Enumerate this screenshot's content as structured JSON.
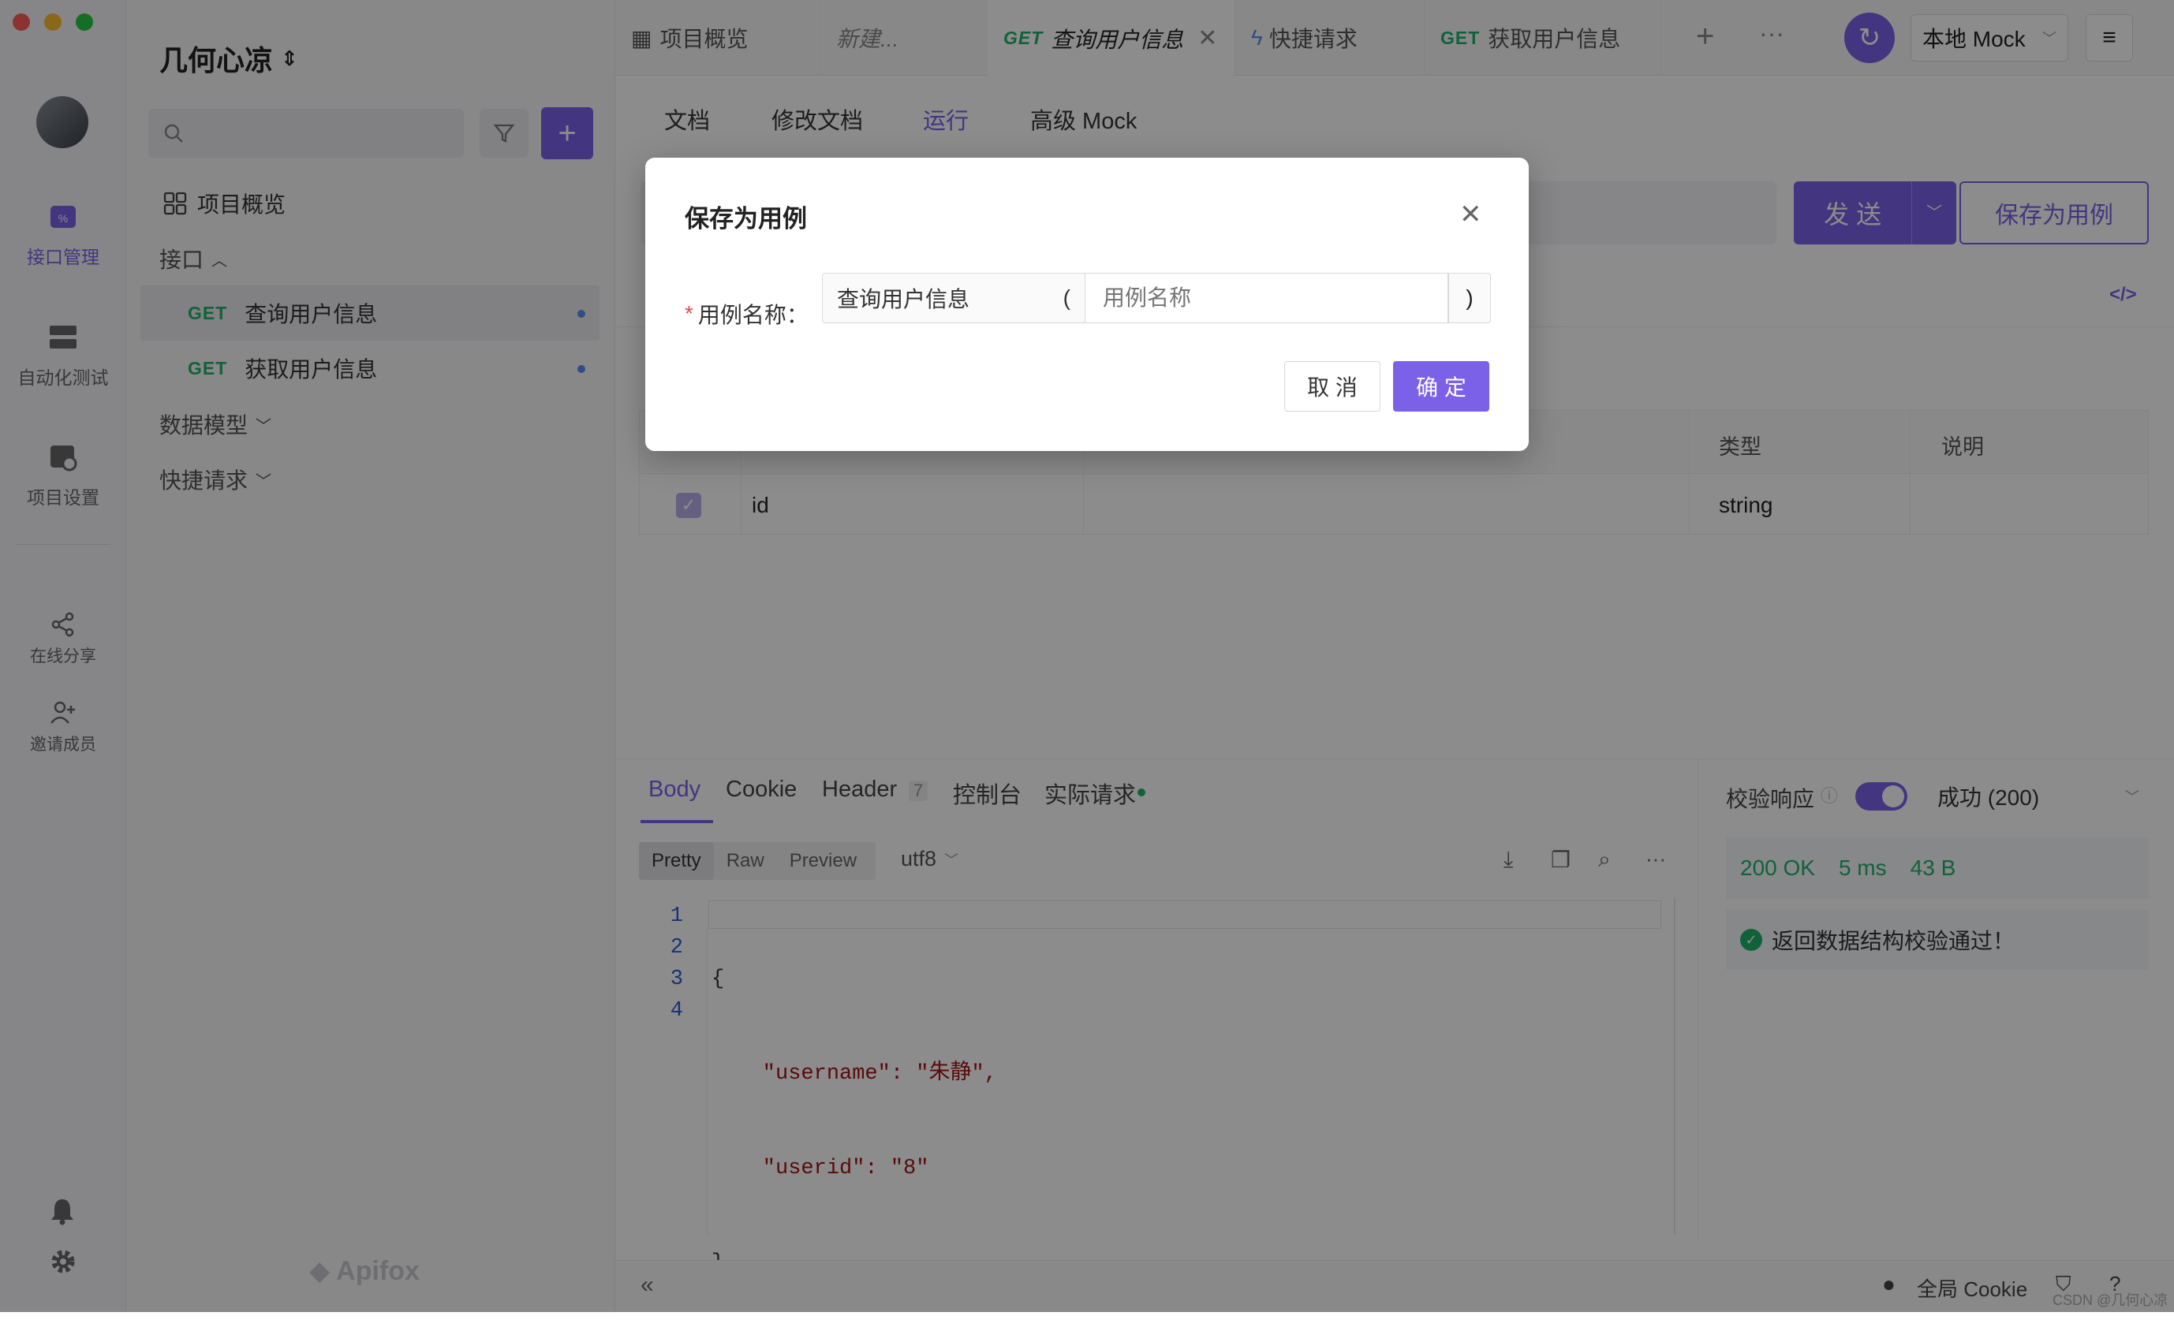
{
  "rail": {
    "items": [
      {
        "label": "接口管理",
        "icon": "api-icon"
      },
      {
        "label": "自动化测试",
        "icon": "automation-icon"
      },
      {
        "label": "项目设置",
        "icon": "settings-icon"
      },
      {
        "label": "在线分享",
        "icon": "share-icon"
      },
      {
        "label": "邀请成员",
        "icon": "invite-icon"
      }
    ]
  },
  "sidebar": {
    "project_name": "几何心凉",
    "overview": "项目概览",
    "interfaces_group": "接口",
    "interfaces": [
      {
        "method": "GET",
        "name": "查询用户信息"
      },
      {
        "method": "GET",
        "name": "获取用户信息"
      }
    ],
    "data_models": "数据模型",
    "quick_requests": "快捷请求",
    "brand": "Apifox"
  },
  "tabs": [
    {
      "label": "项目概览"
    },
    {
      "label": "新建..."
    },
    {
      "method": "GET",
      "label": "查询用户信息"
    },
    {
      "label": "快捷请求"
    },
    {
      "method": "GET",
      "label": "获取用户信息"
    }
  ],
  "env_select": "本地 Mock",
  "subtabs": [
    "文档",
    "修改文档",
    "运行",
    "高级 Mock"
  ],
  "send_button": "发 送",
  "save_case_button": "保存为用例",
  "params_table": {
    "headers": [
      "类型",
      "说明"
    ],
    "rows": [
      {
        "name": "id",
        "type": "string"
      }
    ]
  },
  "response": {
    "tabs": [
      "Body",
      "Cookie",
      "Header",
      "控制台",
      "实际请求"
    ],
    "header_count": "7",
    "format_tabs": [
      "Pretty",
      "Raw",
      "Preview"
    ],
    "encoding": "utf8",
    "code_lines": [
      "{",
      "    \"username\": \"朱静\",",
      "    \"userid\": \"8\"",
      "}"
    ],
    "line_numbers": [
      "1",
      "2",
      "3",
      "4"
    ],
    "validate_label": "校验响应",
    "status_select": "成功 (200)",
    "status_ok": "200 OK",
    "time": "5 ms",
    "size": "43 B",
    "validate_msg": "返回数据结构校验通过！"
  },
  "footer": {
    "global_cookie": "全局 Cookie",
    "watermark": "CSDN @几何心凉"
  },
  "modal": {
    "title": "保存为用例",
    "field_label": "用例名称：",
    "required_mark": "*",
    "prefix_value": "查询用户信息",
    "open_paren": "(",
    "close_paren": ")",
    "input_placeholder": "用例名称",
    "cancel": "取 消",
    "confirm": "确 定"
  },
  "colors": {
    "accent": "#7b61e8",
    "get_method": "#20b26b",
    "success": "#20b26b"
  }
}
